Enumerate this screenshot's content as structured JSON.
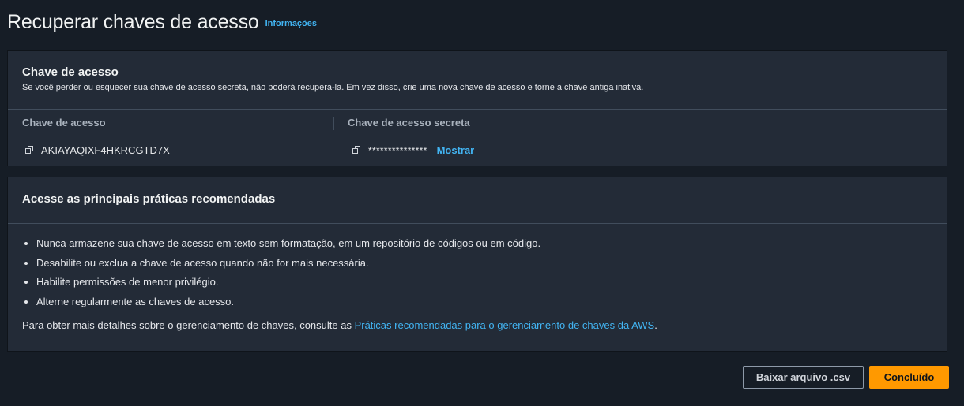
{
  "header": {
    "title": "Recuperar chaves de acesso",
    "info_link": "Informações"
  },
  "access_key_panel": {
    "title": "Chave de acesso",
    "description": "Se você perder ou esquecer sua chave de acesso secreta, não poderá recuperá-la. Em vez disso, crie uma nova chave de acesso e torne a chave antiga inativa.",
    "columns": [
      "Chave de acesso",
      "Chave de acesso secreta"
    ],
    "row": {
      "access_key": "AKIAYAQIXF4HKRCGTD7X",
      "secret_masked": "***************",
      "show_label": "Mostrar"
    },
    "icons": {
      "copy": "copy-icon"
    }
  },
  "practices_panel": {
    "title": "Acesse as principais práticas recomendadas",
    "items": [
      "Nunca armazene sua chave de acesso em texto sem formatação, em um repositório de códigos ou em código.",
      "Desabilite ou exclua a chave de acesso quando não for mais necessária.",
      "Habilite permissões de menor privilégio.",
      "Alterne regularmente as chaves de acesso."
    ],
    "footer_text": "Para obter mais detalhes sobre o gerenciamento de chaves, consulte as ",
    "footer_link": "Práticas recomendadas para o gerenciamento de chaves da AWS",
    "footer_end": "."
  },
  "actions": {
    "download": "Baixar arquivo .csv",
    "done": "Concluído"
  },
  "colors": {
    "background": "#161d26",
    "panel": "#232b37",
    "link": "#42b4f2",
    "primary_button": "#ff9900"
  }
}
